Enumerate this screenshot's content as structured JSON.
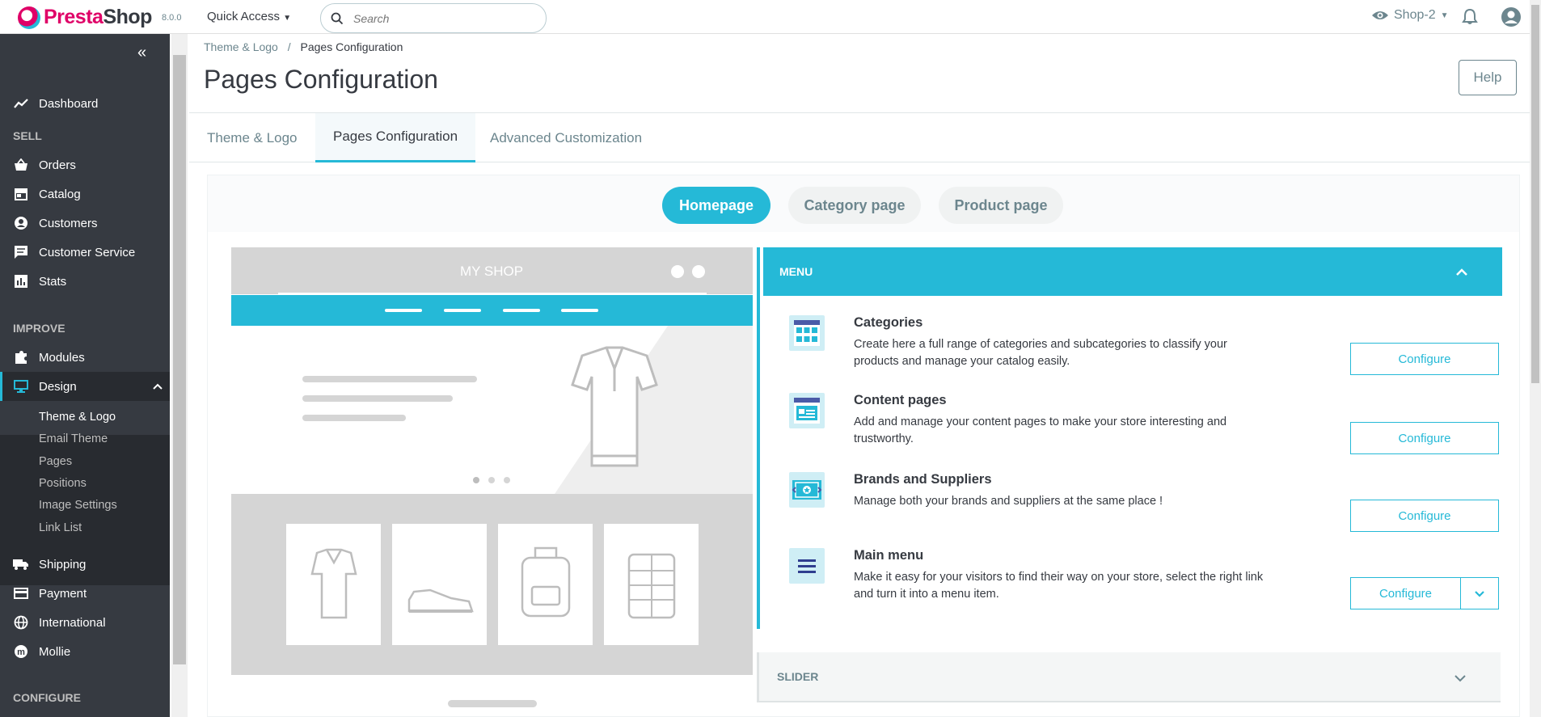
{
  "topbar": {
    "brand_pre": "Presta",
    "brand_post": "Shop",
    "version": "8.0.0",
    "quick_access": "Quick Access",
    "search_placeholder": "Search",
    "shop_name": "Shop-2"
  },
  "sidebar": {
    "dashboard": "Dashboard",
    "sec_sell": "SELL",
    "orders": "Orders",
    "catalog": "Catalog",
    "customers": "Customers",
    "customer_service": "Customer Service",
    "stats": "Stats",
    "sec_improve": "IMPROVE",
    "modules": "Modules",
    "design": "Design",
    "design_sub": [
      "Theme & Logo",
      "Email Theme",
      "Pages",
      "Positions",
      "Image Settings",
      "Link List"
    ],
    "shipping": "Shipping",
    "payment": "Payment",
    "international": "International",
    "mollie": "Mollie",
    "sec_configure": "CONFIGURE"
  },
  "header": {
    "breadcrumb_parent": "Theme & Logo",
    "breadcrumb_sep": "/",
    "breadcrumb_current": "Pages Configuration",
    "title": "Pages Configuration",
    "help": "Help"
  },
  "tabs": [
    "Theme & Logo",
    "Pages Configuration",
    "Advanced Customization"
  ],
  "page_tabs": [
    "Homepage",
    "Category page",
    "Product page"
  ],
  "preview": {
    "shop_name": "MY SHOP"
  },
  "menu": {
    "heading": "MENU",
    "items": [
      {
        "title": "Categories",
        "desc": "Create here a full range of categories and subcategories to classify your products and manage your catalog easily.",
        "button": "Configure"
      },
      {
        "title": "Content pages",
        "desc": "Add and manage your content pages to make your store interesting and trustworthy.",
        "button": "Configure"
      },
      {
        "title": "Brands and Suppliers",
        "desc": "Manage both your brands and suppliers at the same place !",
        "button": "Configure"
      },
      {
        "title": "Main menu",
        "desc": "Make it easy for your visitors to find their way on your store, select the right link and turn it into a menu item.",
        "button": "Configure"
      }
    ]
  },
  "slider": {
    "heading": "SLIDER"
  },
  "colors": {
    "accent": "#25b9d7",
    "sidebar": "#363a41",
    "brand": "#df0067"
  }
}
